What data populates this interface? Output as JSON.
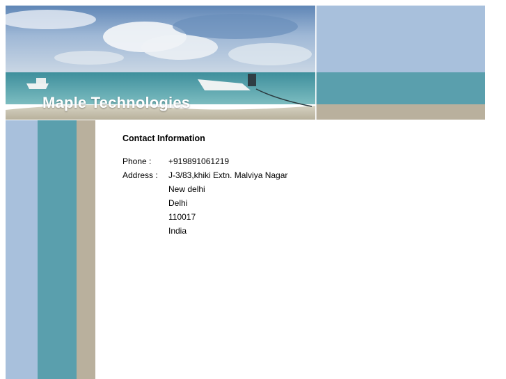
{
  "site": {
    "title": "Maple Technologies"
  },
  "contact": {
    "heading": "Contact Information",
    "phone_label": "Phone :",
    "phone": "+919891061219",
    "address_label": "Address :",
    "address_lines": [
      "J-3/83,khiki Extn. Malviya Nagar",
      "New delhi",
      "Delhi",
      "110017",
      "India"
    ]
  },
  "colors": {
    "sky_blue": "#a8c0dc",
    "teal": "#5a9fad",
    "tan": "#b9b09d"
  }
}
